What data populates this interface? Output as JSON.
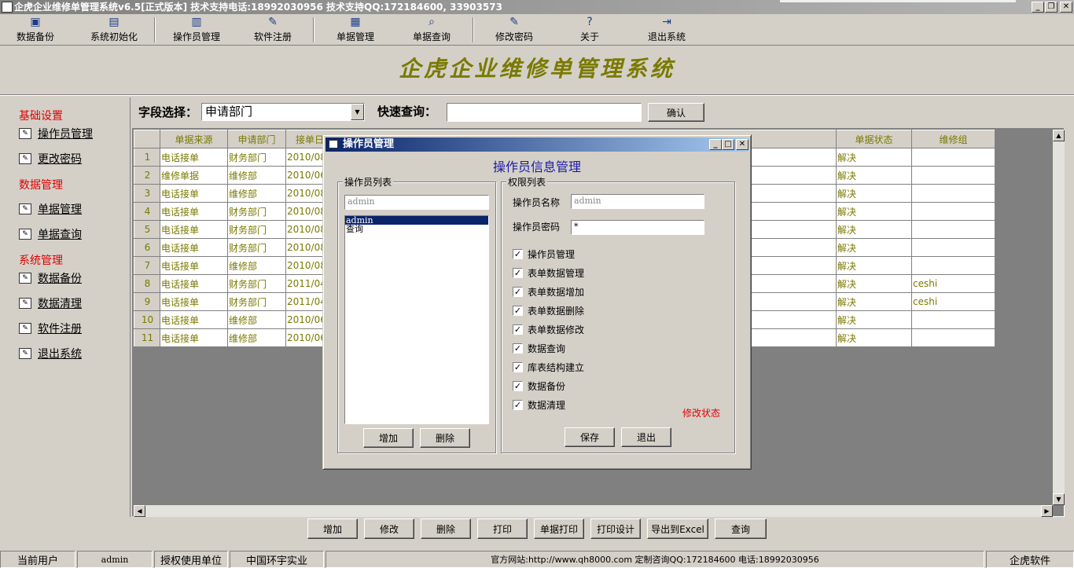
{
  "window": {
    "title": "企虎企业维修单管理系统v6.5[正式版本] 技术支持电话:18992030956 技术支持QQ:172184600, 33903573",
    "minimize": "_",
    "maximize": "❐",
    "close": "✕"
  },
  "toolbar": {
    "items": [
      {
        "label": "数据备份",
        "icon": "save-icon"
      },
      {
        "label": "系统初始化",
        "icon": "document-icon"
      },
      {
        "label": "操作员管理",
        "icon": "monitor-icon"
      },
      {
        "label": "软件注册",
        "icon": "pen-icon"
      },
      {
        "label": "单据管理",
        "icon": "spreadsheet-icon"
      },
      {
        "label": "单据查询",
        "icon": "magnifier-icon"
      },
      {
        "label": "修改密码",
        "icon": "pen-icon"
      },
      {
        "label": "关于",
        "icon": "help-icon"
      },
      {
        "label": "退出系统",
        "icon": "exit-icon"
      }
    ]
  },
  "app_title": "企虎企业维修单管理系统",
  "sidebar": {
    "sections": [
      {
        "title": "基础设置",
        "items": [
          "操作员管理",
          "更改密码"
        ]
      },
      {
        "title": "数据管理",
        "items": [
          "单据管理",
          "单据查询"
        ]
      },
      {
        "title": "系统管理",
        "items": [
          "数据备份",
          "数据清理",
          "软件注册",
          "退出系统"
        ]
      }
    ]
  },
  "query": {
    "field_label": "字段选择：",
    "field_value": "申请部门",
    "quick_label": "快速查询：",
    "quick_value": "",
    "confirm": "确认"
  },
  "grid": {
    "columns": [
      "单据来源",
      "申请部门",
      "接单日",
      "单据状态",
      "维修组"
    ],
    "rows": [
      {
        "n": "1",
        "source": "电话接单",
        "dept": "财务部门",
        "date": "2010/08/",
        "status": "解决",
        "group": ""
      },
      {
        "n": "2",
        "source": "维修单据",
        "dept": "维修部",
        "date": "2010/06/",
        "status": "解决",
        "group": ""
      },
      {
        "n": "3",
        "source": "电话接单",
        "dept": "维修部",
        "date": "2010/08/",
        "status": "解决",
        "group": ""
      },
      {
        "n": "4",
        "source": "电话接单",
        "dept": "财务部门",
        "date": "2010/08/",
        "status": "解决",
        "group": ""
      },
      {
        "n": "5",
        "source": "电话接单",
        "dept": "财务部门",
        "date": "2010/08/",
        "status": "解决",
        "group": ""
      },
      {
        "n": "6",
        "source": "电话接单",
        "dept": "财务部门",
        "date": "2010/08/",
        "status": "解决",
        "group": ""
      },
      {
        "n": "7",
        "source": "电话接单",
        "dept": "维修部",
        "date": "2010/08/",
        "status": "解决",
        "group": ""
      },
      {
        "n": "8",
        "source": "电话接单",
        "dept": "财务部门",
        "date": "2011/04/",
        "status": "解决",
        "group": "ceshi"
      },
      {
        "n": "9",
        "source": "电话接单",
        "dept": "财务部门",
        "date": "2011/04/",
        "status": "解决",
        "group": "ceshi"
      },
      {
        "n": "10",
        "source": "电话接单",
        "dept": "维修部",
        "date": "2010/06/",
        "status": "解决",
        "group": ""
      },
      {
        "n": "11",
        "source": "电话接单",
        "dept": "维修部",
        "date": "2010/06/",
        "status": "解决",
        "group": ""
      }
    ]
  },
  "bottom_buttons": [
    "增加",
    "修改",
    "删除",
    "打印",
    "单据打印",
    "打印设计",
    "导出到Excel",
    "查询"
  ],
  "statusbar": {
    "user_label": "当前用户",
    "user": "admin",
    "licensed_label": "授权使用单位",
    "licensed": "中国环宇实业",
    "website": "官方网站:http://www.qh8000.com 定制咨询QQ:172184600 电话:18992030956",
    "brand": "企虎软件"
  },
  "dialog": {
    "title": "操作员管理",
    "heading": "操作员信息管理",
    "operator_list_label": "操作员列表",
    "list_input": "admin",
    "list_items": [
      "admin",
      "查询"
    ],
    "selected_index": 0,
    "add": "增加",
    "delete": "删除",
    "perm_label": "权限列表",
    "name_label": "操作员名称",
    "name_value": "admin",
    "password_label": "操作员密码",
    "password_value": "*",
    "permissions": [
      {
        "label": "操作员管理",
        "checked": true
      },
      {
        "label": "表单数据管理",
        "checked": true
      },
      {
        "label": "表单数据增加",
        "checked": true
      },
      {
        "label": "表单数据删除",
        "checked": true
      },
      {
        "label": "表单数据修改",
        "checked": true
      },
      {
        "label": "数据查询",
        "checked": true
      },
      {
        "label": "库表结构建立",
        "checked": true
      },
      {
        "label": "数据备份",
        "checked": true
      },
      {
        "label": "数据清理",
        "checked": true
      }
    ],
    "modify_status": "修改状态",
    "save": "保存",
    "exit": "退出"
  }
}
